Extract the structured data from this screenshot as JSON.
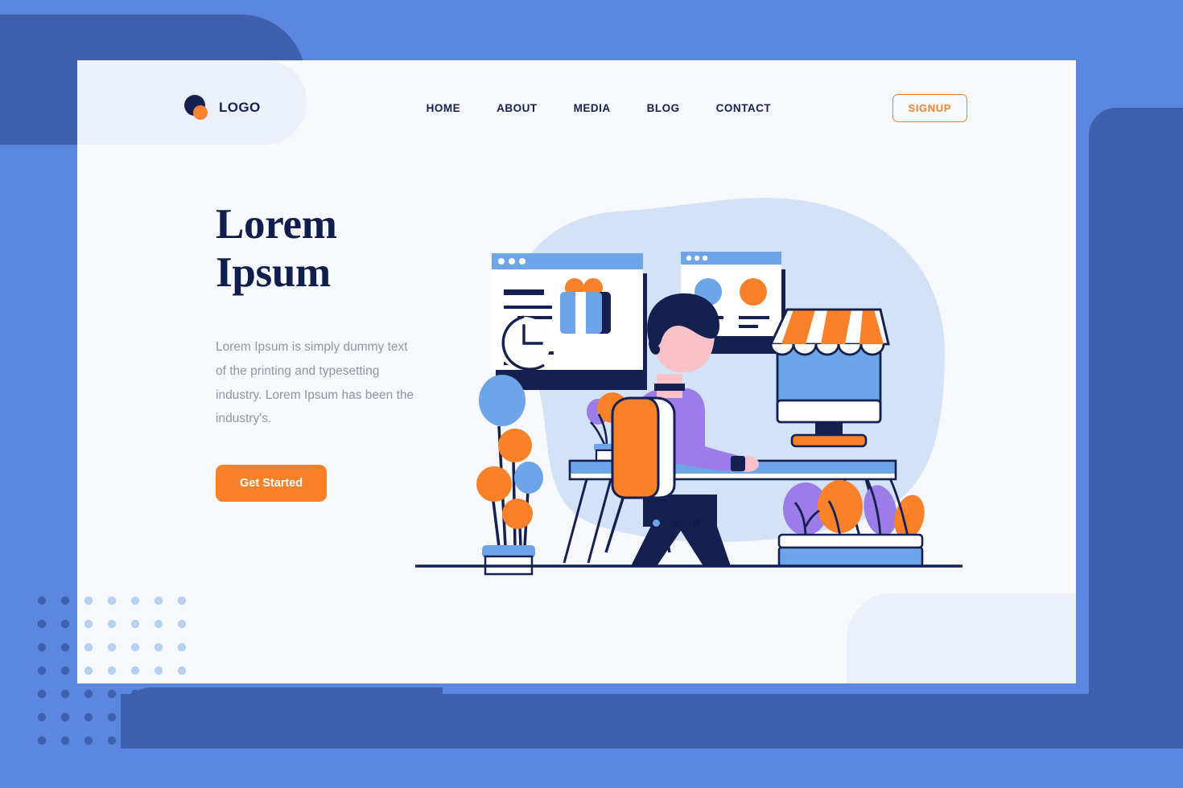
{
  "brand": {
    "logo_text": "LOGO",
    "logo_icon_primary": "circle-navy-icon",
    "logo_icon_secondary": "circle-orange-icon"
  },
  "nav": {
    "items": [
      {
        "label": "HOME"
      },
      {
        "label": "ABOUT"
      },
      {
        "label": "MEDIA"
      },
      {
        "label": "BLOG"
      },
      {
        "label": "CONTACT"
      }
    ],
    "signup_label": "SIGNUP"
  },
  "hero": {
    "title_line1": "Lorem",
    "title_line2": "Ipsum",
    "paragraph": "Lorem Ipsum is simply dummy text of the printing and typesetting industry. Lorem Ipsum has been the industry's.",
    "cta_label": "Get Started"
  },
  "carousel": {
    "dots": [
      {
        "state": "active",
        "color": "#6ea4e8"
      },
      {
        "state": "inactive",
        "color": "#121c49"
      },
      {
        "state": "inactive",
        "color": "#121c49"
      }
    ]
  },
  "illustration": {
    "name": "man-working-at-desk-ecommerce-illustration",
    "elements": [
      "browser-window-product",
      "browser-window-stats",
      "wall-clock",
      "tall-plant-circles",
      "desk-small-plant",
      "man-sitting-purple-shirt",
      "orange-office-chair",
      "blue-desk",
      "storefront-monitor",
      "floor-planter-box"
    ]
  },
  "colors": {
    "page_background": "#5b87e0",
    "background_dark_blue": "#3e60ad",
    "card_background": "#f7f9fd",
    "card_accent_shape": "#ebf0fa",
    "navy": "#14204f",
    "orange": "#f9812a",
    "blue": "#6ea4e8",
    "light_blue": "#cfe0f7",
    "purple": "#9b7ce8",
    "skin": "#f9c2c9",
    "muted_text": "#8d96a5"
  }
}
